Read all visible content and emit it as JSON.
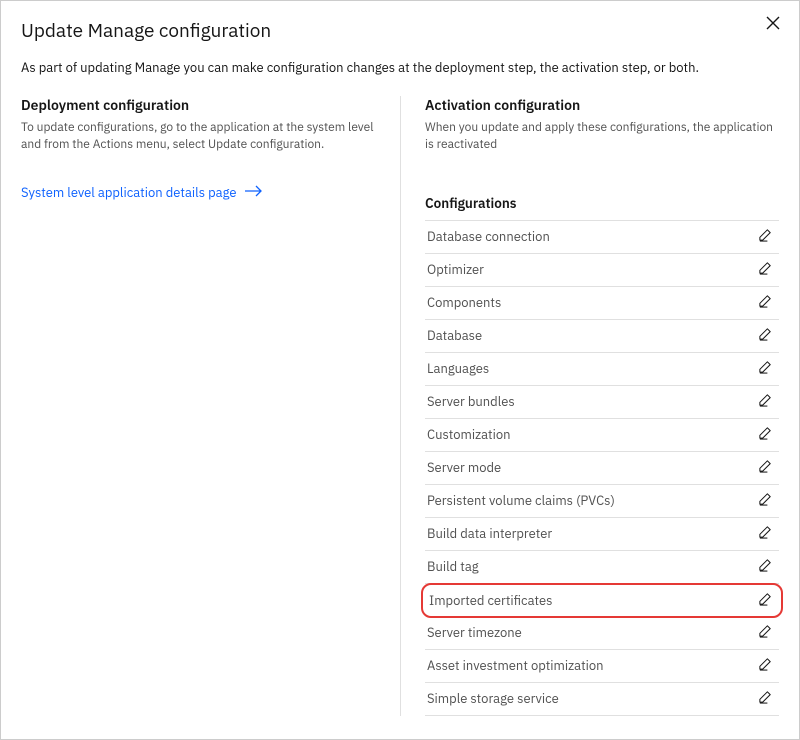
{
  "modal": {
    "title": "Update Manage configuration",
    "intro": "As part of updating Manage you can make configuration changes at the deployment step, the activation step, or both."
  },
  "deployment": {
    "heading": "Deployment configuration",
    "desc": "To update configurations, go to the application at the system level and from the Actions menu, select Update configuration.",
    "link_label": "System level application details page"
  },
  "activation": {
    "heading": "Activation configuration",
    "desc": "When you update and apply these configurations, the application is reactivated",
    "configs_heading": "Configurations",
    "items": [
      {
        "label": "Database connection"
      },
      {
        "label": "Optimizer"
      },
      {
        "label": "Components"
      },
      {
        "label": "Database"
      },
      {
        "label": "Languages"
      },
      {
        "label": "Server bundles"
      },
      {
        "label": "Customization"
      },
      {
        "label": "Server mode"
      },
      {
        "label": "Persistent volume claims (PVCs)"
      },
      {
        "label": "Build data interpreter"
      },
      {
        "label": "Build tag"
      },
      {
        "label": "Imported certificates",
        "highlighted": true
      },
      {
        "label": "Server timezone"
      },
      {
        "label": "Asset investment optimization"
      },
      {
        "label": "Simple storage service"
      }
    ]
  }
}
